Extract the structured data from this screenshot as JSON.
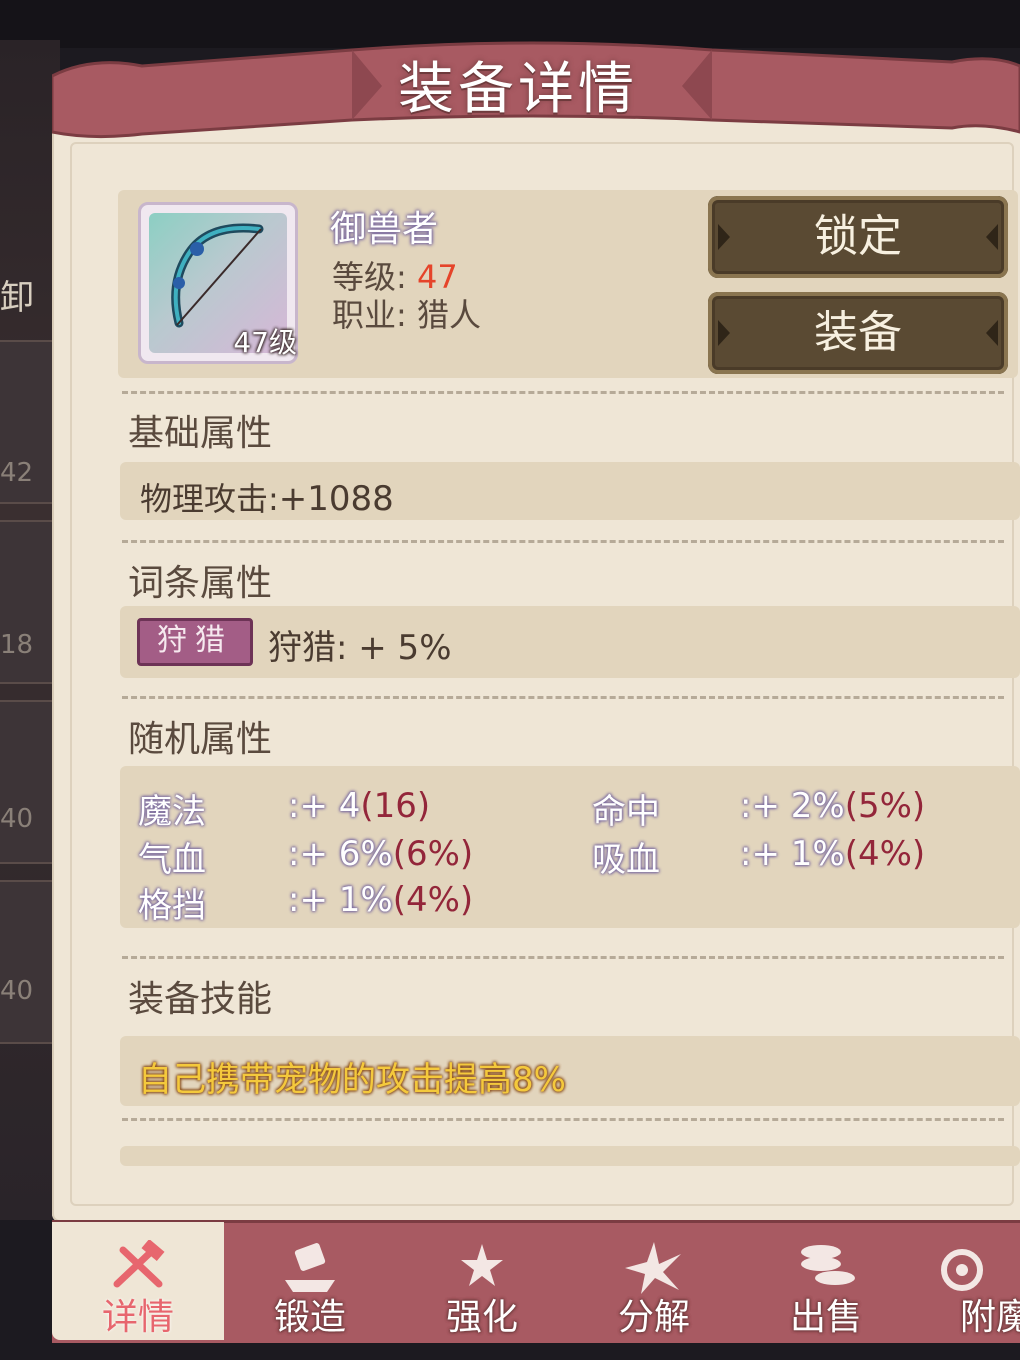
{
  "window": {
    "title": "装备详情"
  },
  "item": {
    "name": "御兽者",
    "icon": "bow-icon",
    "icon_level": "47级",
    "level_label": "等级:",
    "level_value": "47",
    "class_label": "职业:",
    "class_value": "猎人"
  },
  "actions": {
    "lock_label": "锁定",
    "equip_label": "装备"
  },
  "sections": {
    "base": {
      "title": "基础属性",
      "attr_label": "物理攻击:",
      "attr_value": "+1088"
    },
    "affix": {
      "title": "词条属性",
      "badge": "狩猎",
      "text": "狩猎: + 5%"
    },
    "random": {
      "title": "随机属性",
      "rows": [
        {
          "label": "魔法",
          "value": ":+ 4",
          "paren": "(16)"
        },
        {
          "label": "命中",
          "value": ":+ 2%",
          "paren": "(5%)"
        },
        {
          "label": "气血",
          "value": ":+ 6%",
          "paren": "(6%)"
        },
        {
          "label": "吸血",
          "value": ":+ 1%",
          "paren": "(4%)"
        },
        {
          "label": "格挡",
          "value": ":+ 1%",
          "paren": "(4%)"
        }
      ]
    },
    "skill": {
      "title": "装备技能",
      "text": "自己携带宠物的攻击提高8%"
    }
  },
  "background_levels": [
    "42",
    "18",
    "40",
    "40"
  ],
  "background_text": "卸",
  "tabs": [
    {
      "label": "详情",
      "icon": "detail-icon",
      "active": true
    },
    {
      "label": "锻造",
      "icon": "forge-icon",
      "active": false
    },
    {
      "label": "强化",
      "icon": "enhance-icon",
      "active": false
    },
    {
      "label": "分解",
      "icon": "decompose-icon",
      "active": false
    },
    {
      "label": "出售",
      "icon": "sell-icon",
      "active": false
    },
    {
      "label": "附魔",
      "icon": "enchant-icon",
      "active": false
    }
  ],
  "colors": {
    "panel": "#efe6d6",
    "banner": "#a85a62",
    "level_red": "#e5442a",
    "skill_yellow": "#f4c93c",
    "affix_badge": "#a35d86"
  }
}
